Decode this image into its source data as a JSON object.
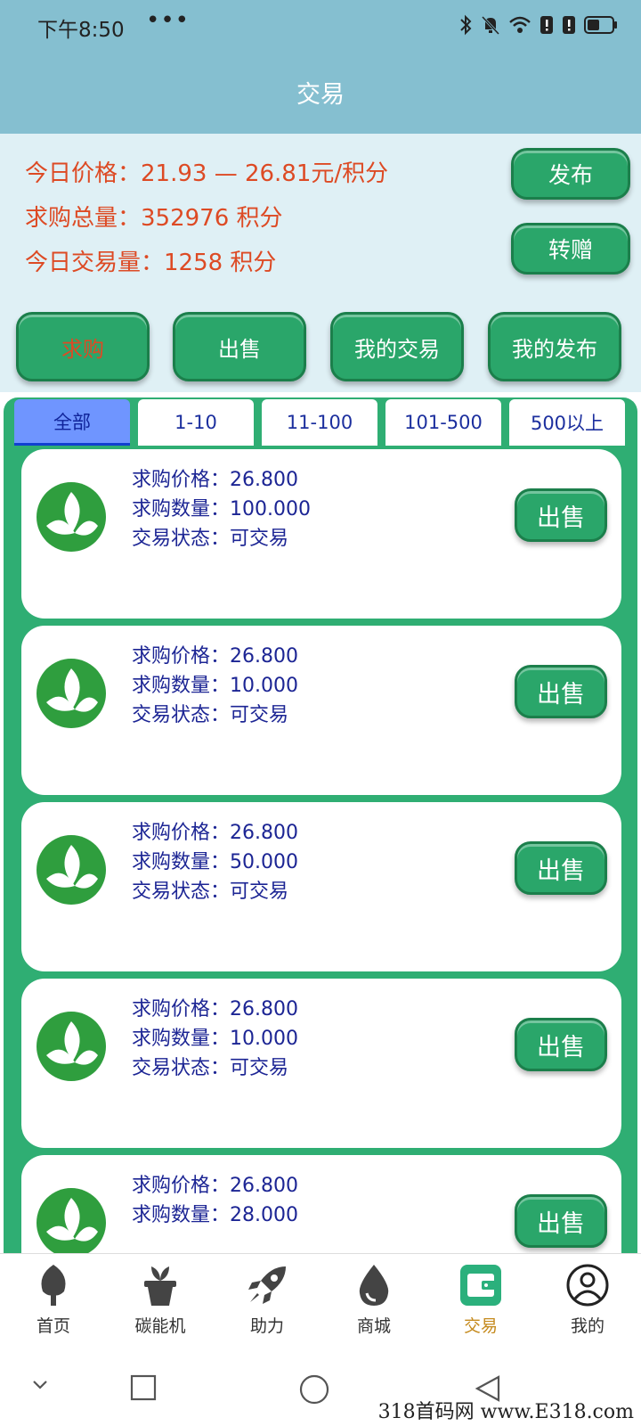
{
  "status_bar": {
    "time": "下午8:50",
    "menu": "•••"
  },
  "header": {
    "title": "交易"
  },
  "info": {
    "price_line": "今日价格：21.93 — 26.81元/积分",
    "demand_line": "求购总量：352976 积分",
    "volume_line": "今日交易量：1258 积分"
  },
  "actions": {
    "publish": "发布",
    "transfer": "转赠"
  },
  "main_tabs": [
    "求购",
    "出售",
    "我的交易",
    "我的发布"
  ],
  "filters": [
    "全部",
    "1-10",
    "11-100",
    "101-500",
    "500以上"
  ],
  "orders": [
    {
      "price": "求购价格：26.800",
      "qty": "求购数量：100.000",
      "status": "交易状态：可交易"
    },
    {
      "price": "求购价格：26.800",
      "qty": "求购数量：10.000",
      "status": "交易状态：可交易"
    },
    {
      "price": "求购价格：26.800",
      "qty": "求购数量：50.000",
      "status": "交易状态：可交易"
    },
    {
      "price": "求购价格：26.800",
      "qty": "求购数量：10.000",
      "status": "交易状态：可交易"
    },
    {
      "price": "求购价格：26.800",
      "qty": "求购数量：28.000",
      "status": ""
    }
  ],
  "sell_label": "出售",
  "nav": [
    "首页",
    "碳能机",
    "助力",
    "商城",
    "交易",
    "我的"
  ],
  "watermark": "318首码网 www.E318.com",
  "colors": {
    "header": "#85bfd0",
    "green": "#2aa66a",
    "accent_text": "#dd4a24",
    "nav_active": "#c58a1d"
  }
}
